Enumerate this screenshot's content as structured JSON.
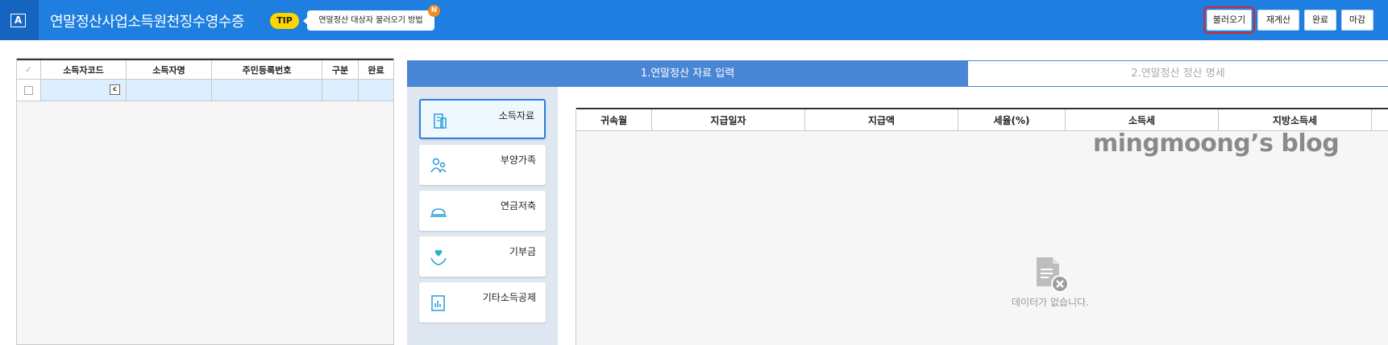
{
  "header": {
    "logo_letter": "A",
    "title": "연말정산사업소득원천징수영수증",
    "tip_badge": "TIP",
    "tip_text": "연말정산 대상자 불러오기 방법",
    "new_badge": "N",
    "buttons": [
      "불러오기",
      "재계산",
      "완료",
      "마감"
    ],
    "highlighted_button": "불러오기",
    "colors": {
      "header_bg": "#1e7fe0",
      "tip_badge": "#ffd500",
      "new_badge": "#f08c1f",
      "highlight_outline": "#d9262b"
    }
  },
  "left_grid": {
    "check_header": "✓",
    "columns": [
      "소득자코드",
      "소득자명",
      "주민등록번호",
      "구분",
      "완료"
    ],
    "rows": [
      {
        "code": "",
        "name": "",
        "resident_no": "",
        "type": "",
        "done": "",
        "calendar_icon": "calendar-icon"
      }
    ]
  },
  "tabs": [
    {
      "label": "1.연말정산 자료 입력",
      "active": true
    },
    {
      "label": "2.연말정산 정산 명세",
      "active": false
    }
  ],
  "side_menu": [
    {
      "label": "소득자료",
      "icon": "document-building-icon",
      "active": true
    },
    {
      "label": "부양가족",
      "icon": "family-icon",
      "active": false
    },
    {
      "label": "연금저축",
      "icon": "savings-icon",
      "active": false
    },
    {
      "label": "기부금",
      "icon": "donation-heart-icon",
      "active": false
    },
    {
      "label": "기타소득공제",
      "icon": "deduction-chart-icon",
      "active": false
    }
  ],
  "income_table": {
    "columns": [
      "귀속월",
      "지급일자",
      "지급액",
      "세율(%)",
      "소득세",
      "지방소득세"
    ],
    "rows": [],
    "empty_message": "데이터가 없습니다.",
    "empty_icon": "no-data-document-icon"
  },
  "watermark": "mingmoong’s blog"
}
